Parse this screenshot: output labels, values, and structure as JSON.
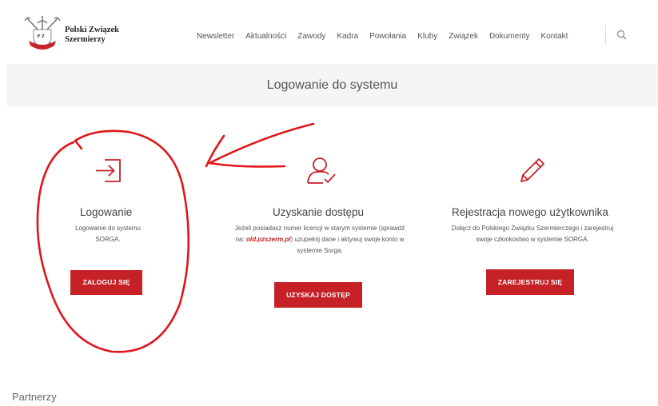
{
  "header": {
    "logo": {
      "line1": "Polski Związek",
      "line2": "Szermierzy",
      "emblem_letters": "P Z"
    },
    "nav": [
      {
        "label": "Newsletter"
      },
      {
        "label": "Aktualności"
      },
      {
        "label": "Zawody"
      },
      {
        "label": "Kadra"
      },
      {
        "label": "Powołania"
      },
      {
        "label": "Kluby"
      },
      {
        "label": "Związek"
      },
      {
        "label": "Dokumenty"
      },
      {
        "label": "Kontakt"
      }
    ],
    "search_icon": "search-icon"
  },
  "page": {
    "title": "Logowanie do systemu"
  },
  "columns": {
    "login": {
      "icon": "login-icon",
      "heading": "Logowanie",
      "desc_line1": "Logowanie do systemu",
      "desc_line2": "SORGA.",
      "button": "ZALOGUJ SIĘ"
    },
    "access": {
      "icon": "user-check-icon",
      "heading": "Uzyskanie dostępu",
      "desc_line1": "Jeżeli posiadasz numer licencji w starym systemie (sprawdź",
      "desc_line2_pre": "na: ",
      "desc_link": "old.pzszerm.pl",
      "desc_line2_post": ") uzupełnij dane i aktywuj swoje konto w",
      "desc_line3": "systemie Sorga.",
      "button": "UZYSKAJ DOSTĘP"
    },
    "register": {
      "icon": "pencil-icon",
      "heading": "Rejestracja nowego użytkownika",
      "desc_line1": "Dołącz do Polskiego Związku Szermierczego i zarejestruj",
      "desc_line2": "swoje członkostwo w systemie SORGA.",
      "button": "ZAREJESTRUJ SIĘ"
    }
  },
  "footer": {
    "partners_heading": "Partnerzy"
  },
  "colors": {
    "accent": "#c62127",
    "titlebar_bg": "#f5f5f5",
    "annotation": "#e0161a"
  }
}
